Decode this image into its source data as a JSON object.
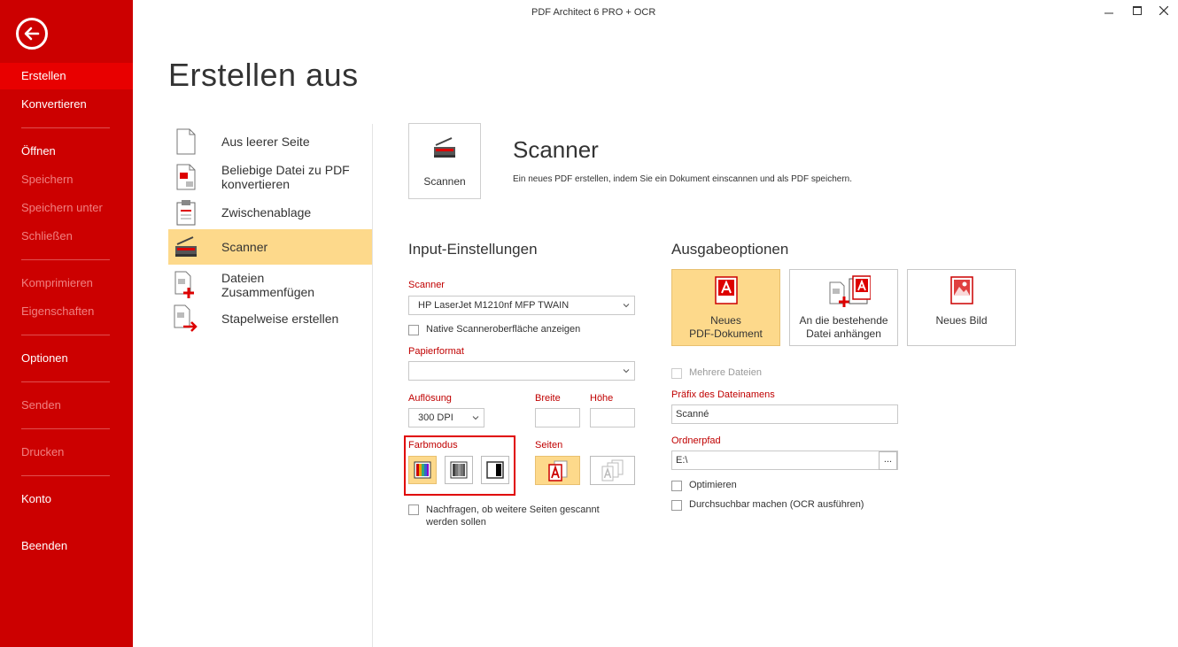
{
  "window": {
    "title": "PDF Architect 6 PRO + OCR"
  },
  "sidebar": {
    "items": [
      {
        "label": "Erstellen"
      },
      {
        "label": "Konvertieren"
      },
      {
        "label": "Öffnen"
      },
      {
        "label": "Speichern"
      },
      {
        "label": "Speichern unter"
      },
      {
        "label": "Schließen"
      },
      {
        "label": "Komprimieren"
      },
      {
        "label": "Eigenschaften"
      },
      {
        "label": "Optionen"
      },
      {
        "label": "Senden"
      },
      {
        "label": "Drucken"
      },
      {
        "label": "Konto"
      },
      {
        "label": "Beenden"
      }
    ]
  },
  "page": {
    "title": "Erstellen aus"
  },
  "create_list": [
    {
      "label": "Aus leerer Seite"
    },
    {
      "label": "Beliebige Datei zu PDF konvertieren"
    },
    {
      "label": "Zwischenablage"
    },
    {
      "label": "Scanner"
    },
    {
      "label": "Dateien Zusammenfügen"
    },
    {
      "label": "Stapelweise erstellen"
    }
  ],
  "scanner": {
    "tile_label": "Scannen",
    "title": "Scanner",
    "description": "Ein neues PDF erstellen, indem Sie ein Dokument einscannen und als PDF speichern."
  },
  "input": {
    "title": "Input-Einstellungen",
    "scanner_label": "Scanner",
    "scanner_value": "HP LaserJet M1210nf MFP TWAIN",
    "native_ui": "Native Scanneroberfläche anzeigen",
    "paper_label": "Papierformat",
    "paper_value": "",
    "resolution_label": "Auflösung",
    "resolution_value": "300 DPI",
    "width_label": "Breite",
    "height_label": "Höhe",
    "color_label": "Farbmodus",
    "pages_label": "Seiten",
    "ask_more_pages": "Nachfragen, ob weitere Seiten gescannt werden sollen"
  },
  "output": {
    "title": "Ausgabeoptionen",
    "tiles": [
      {
        "label_line1": "Neues",
        "label_line2": "PDF-Dokument"
      },
      {
        "label_line1": "An die bestehende",
        "label_line2": "Datei anhängen"
      },
      {
        "label_line1": "Neues Bild",
        "label_line2": ""
      }
    ],
    "multiple_files": "Mehrere Dateien",
    "prefix_label": "Präfix des Dateinamens",
    "prefix_value": "Scanné",
    "folder_label": "Ordnerpfad",
    "folder_value": "E:\\",
    "browse_label": "...",
    "optimize": "Optimieren",
    "ocr": "Durchsuchbar machen (OCR ausführen)"
  },
  "colors": {
    "sidebar": "#cc0000",
    "accent": "#c00000",
    "selected": "#fdd98b"
  }
}
